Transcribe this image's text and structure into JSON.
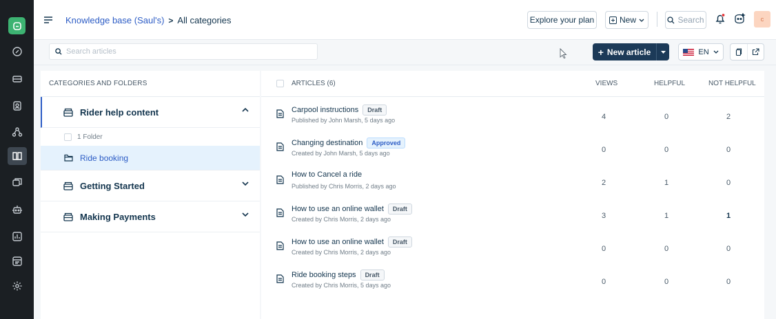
{
  "header": {
    "breadcrumb_root": "Knowledge base (Saul's)",
    "breadcrumb_sep": ">",
    "breadcrumb_current": "All categories",
    "explore_label": "Explore your plan",
    "new_label": "New",
    "search_label": "Search",
    "avatar_initial": "c"
  },
  "toolbar": {
    "search_placeholder": "Search articles",
    "new_article_label": "New article",
    "language": "EN"
  },
  "categories": {
    "heading": "CATEGORIES AND FOLDERS",
    "items": [
      {
        "label": "Rider help content",
        "expanded": true
      },
      {
        "label": "Getting Started",
        "expanded": false
      },
      {
        "label": "Making Payments",
        "expanded": false
      }
    ],
    "folder_count": "1 Folder",
    "subfolder": "Ride booking"
  },
  "articles": {
    "heading": "ARTICLES (6)",
    "col_views": "VIEWS",
    "col_helpful": "HELPFUL",
    "col_not_helpful": "NOT HELPFUL",
    "rows": [
      {
        "title": "Carpool instructions",
        "status": "Draft",
        "meta": "Published by John Marsh, 5 days ago",
        "views": "4",
        "helpful": "0",
        "not_helpful": "2"
      },
      {
        "title": "Changing destination",
        "status": "Approved",
        "meta": "Created by John Marsh, 5 days ago",
        "views": "0",
        "helpful": "0",
        "not_helpful": "0"
      },
      {
        "title": "How to Cancel a ride",
        "status": "",
        "meta": "Published by Chris Morris, 2 days ago",
        "views": "2",
        "helpful": "1",
        "not_helpful": "0"
      },
      {
        "title": "How to use an online wallet",
        "status": "Draft",
        "meta": "Created by Chris Morris, 2 days ago",
        "views": "3",
        "helpful": "1",
        "not_helpful": "1"
      },
      {
        "title": "How to use an online wallet",
        "status": "Draft",
        "meta": "Created by Chris Morris, 2 days ago",
        "views": "0",
        "helpful": "0",
        "not_helpful": "0"
      },
      {
        "title": "Ride booking steps",
        "status": "Draft",
        "meta": "Created by Chris Morris, 5 days ago",
        "views": "0",
        "helpful": "0",
        "not_helpful": "0"
      }
    ]
  },
  "colors": {
    "rail": "#1b1f23",
    "brand": "#3db372",
    "primary": "#1c3a58",
    "link": "#2c5cc5",
    "notification": "#e43538"
  }
}
